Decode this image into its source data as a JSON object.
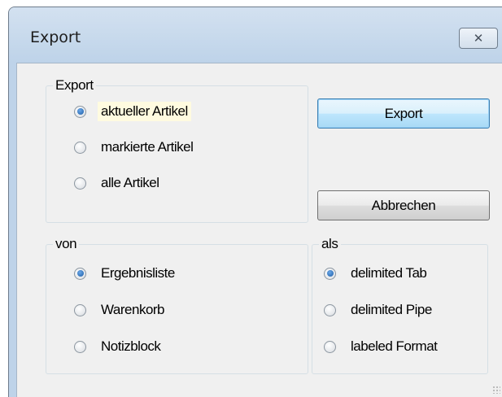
{
  "window": {
    "title": "Export",
    "close_label": "✕"
  },
  "export_group": {
    "legend": "Export",
    "options": [
      "aktueller Artikel",
      "markierte Artikel",
      "alle Artikel"
    ],
    "selected": 0
  },
  "buttons": {
    "export": "Export",
    "cancel": "Abbrechen"
  },
  "source_group": {
    "legend": "von",
    "options": [
      "Ergebnisliste",
      "Warenkorb",
      "Notizblock"
    ],
    "selected": 0
  },
  "format_group": {
    "legend": "als",
    "options": [
      "delimited Tab",
      "delimited Pipe",
      "labeled Format"
    ],
    "selected": 0
  }
}
